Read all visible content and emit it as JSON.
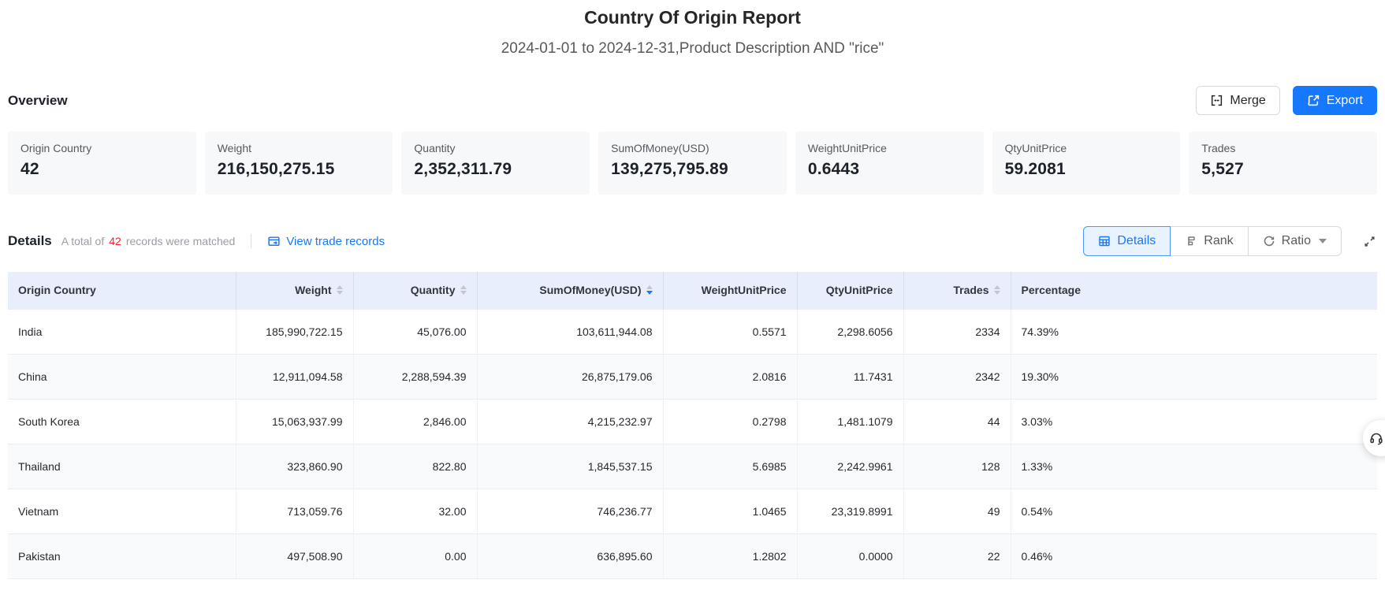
{
  "report": {
    "title": "Country Of Origin Report",
    "subtitle": "2024-01-01 to 2024-12-31,Product Description AND \"rice\""
  },
  "overview": {
    "heading": "Overview",
    "merge_label": "Merge",
    "export_label": "Export",
    "cards": [
      {
        "label": "Origin Country",
        "value": "42"
      },
      {
        "label": "Weight",
        "value": "216,150,275.15"
      },
      {
        "label": "Quantity",
        "value": "2,352,311.79"
      },
      {
        "label": "SumOfMoney(USD)",
        "value": "139,275,795.89"
      },
      {
        "label": "WeightUnitPrice",
        "value": "0.6443"
      },
      {
        "label": "QtyUnitPrice",
        "value": "59.2081"
      },
      {
        "label": "Trades",
        "value": "5,527"
      }
    ]
  },
  "details": {
    "heading": "Details",
    "total_prefix": "A total of",
    "total_count": "42",
    "total_suffix": "records were matched",
    "view_link": "View trade records",
    "tabs": {
      "details": "Details",
      "rank": "Rank",
      "ratio": "Ratio"
    },
    "active_tab": "Details"
  },
  "table": {
    "columns": [
      {
        "label": "Origin Country",
        "sortable": false,
        "align": "left"
      },
      {
        "label": "Weight",
        "sortable": true,
        "align": "right"
      },
      {
        "label": "Quantity",
        "sortable": true,
        "align": "right"
      },
      {
        "label": "SumOfMoney(USD)",
        "sortable": true,
        "align": "right",
        "sorted": "desc"
      },
      {
        "label": "WeightUnitPrice",
        "sortable": false,
        "align": "right"
      },
      {
        "label": "QtyUnitPrice",
        "sortable": false,
        "align": "right"
      },
      {
        "label": "Trades",
        "sortable": true,
        "align": "right"
      },
      {
        "label": "Percentage",
        "sortable": false,
        "align": "left"
      }
    ],
    "rows": [
      {
        "country": "India",
        "weight": "185,990,722.15",
        "quantity": "45,076.00",
        "sum": "103,611,944.08",
        "weight_unit_price": "0.5571",
        "qty_unit_price": "2,298.6056",
        "trades": "2334",
        "percentage": "74.39%"
      },
      {
        "country": "China",
        "weight": "12,911,094.58",
        "quantity": "2,288,594.39",
        "sum": "26,875,179.06",
        "weight_unit_price": "2.0816",
        "qty_unit_price": "11.7431",
        "trades": "2342",
        "percentage": "19.30%"
      },
      {
        "country": "South Korea",
        "weight": "15,063,937.99",
        "quantity": "2,846.00",
        "sum": "4,215,232.97",
        "weight_unit_price": "0.2798",
        "qty_unit_price": "1,481.1079",
        "trades": "44",
        "percentage": "3.03%"
      },
      {
        "country": "Thailand",
        "weight": "323,860.90",
        "quantity": "822.80",
        "sum": "1,845,537.15",
        "weight_unit_price": "5.6985",
        "qty_unit_price": "2,242.9961",
        "trades": "128",
        "percentage": "1.33%"
      },
      {
        "country": "Vietnam",
        "weight": "713,059.76",
        "quantity": "32.00",
        "sum": "746,236.77",
        "weight_unit_price": "1.0465",
        "qty_unit_price": "23,319.8991",
        "trades": "49",
        "percentage": "0.54%"
      },
      {
        "country": "Pakistan",
        "weight": "497,508.90",
        "quantity": "0.00",
        "sum": "636,895.60",
        "weight_unit_price": "1.2802",
        "qty_unit_price": "0.0000",
        "trades": "22",
        "percentage": "0.46%"
      }
    ]
  },
  "icons": {
    "merge": "merge-cells-icon",
    "export": "export-icon",
    "view_records": "trade-records-icon",
    "details_tab": "table-grid-icon",
    "rank_tab": "rank-icon",
    "ratio_tab": "ratio-ring-icon",
    "expand": "fullscreen-icon",
    "helper": "headset-icon"
  },
  "colors": {
    "accent_blue": "#1677ff",
    "count_red": "#f5222d",
    "table_header_bg": "#e8eefb",
    "card_bg": "#f7f8fa",
    "active_tab_bg": "#e9f3ff"
  }
}
